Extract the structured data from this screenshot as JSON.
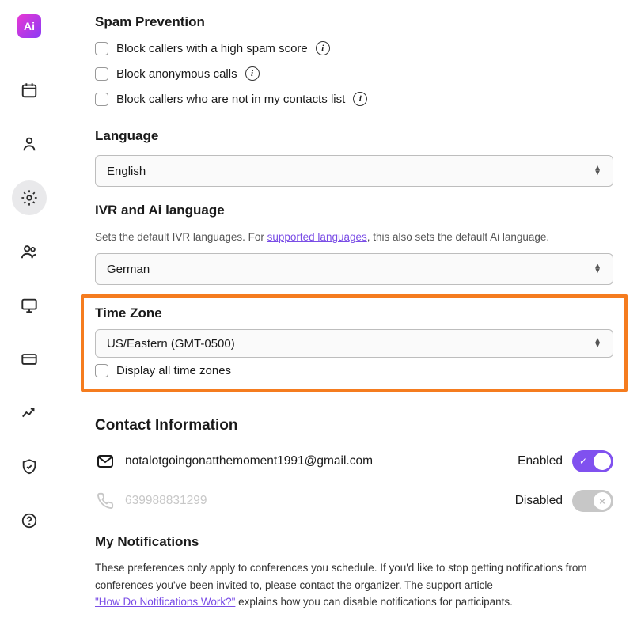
{
  "spam": {
    "header": "Spam Prevention",
    "opt1": "Block callers with a high spam score",
    "opt2": "Block anonymous calls",
    "opt3": "Block callers who are not in my contacts list"
  },
  "language": {
    "header": "Language",
    "value": "English"
  },
  "ivr": {
    "header": "IVR and Ai language",
    "desc_pre": "Sets the default IVR languages. For ",
    "desc_link": "supported languages",
    "desc_post": ", this also sets the default Ai language.",
    "value": "German"
  },
  "timezone": {
    "header": "Time Zone",
    "value": "US/Eastern (GMT-0500)",
    "checkbox_label": "Display all time zones"
  },
  "contact": {
    "header": "Contact Information",
    "email": "notalotgoingonatthemoment1991@gmail.com",
    "email_status": "Enabled",
    "phone": "639988831299",
    "phone_status": "Disabled"
  },
  "notifications": {
    "header": "My Notifications",
    "text_a": "These preferences only apply to conferences you schedule. If you'd like to stop getting notifications from conferences you've been invited to, please contact the organizer. The support article ",
    "link": "\"How Do Notifications Work?\"",
    "text_b": " explains how you can disable notifications for participants."
  }
}
